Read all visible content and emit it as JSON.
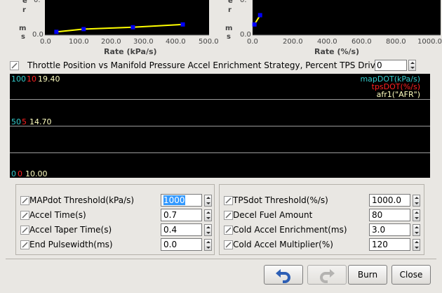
{
  "left_chart": {
    "y_axis_letters": [
      "e",
      "r",
      "m",
      "s"
    ],
    "y_ticks": [
      "0.0"
    ],
    "x_ticks": [
      "0.0",
      "100.0",
      "200.0",
      "300.0",
      "400.0",
      "500.0"
    ],
    "x_label": "Rate (kPa/s)"
  },
  "right_chart": {
    "y_axis_letters": [
      "e",
      "r",
      "m",
      "s"
    ],
    "y_ticks": [
      "0.0"
    ],
    "x_ticks": [
      "0.0",
      "200.0",
      "400.0",
      "600.0",
      "800.0",
      "1000.0"
    ],
    "x_label": "Rate (%/s)"
  },
  "chart_data": [
    {
      "type": "line",
      "xlabel": "Rate (kPa/s)",
      "x": [
        35,
        118,
        268,
        420
      ],
      "y": [
        0.1,
        0.25,
        0.35,
        0.5
      ],
      "xlim": [
        0,
        500
      ],
      "line_color": "#ffff00",
      "point_color": "#0000ff"
    },
    {
      "type": "line",
      "xlabel": "Rate (%/s)",
      "x": [
        10,
        40
      ],
      "y": [
        0.5,
        1.0
      ],
      "xlim": [
        0,
        1000
      ],
      "line_color": "#ffff00",
      "point_color": "#0000ff"
    }
  ],
  "strategy": {
    "label": "Throttle Position vs Manifold Pressure Accel Enrichment Strategy, Percent TPS Driven(%)",
    "value": "0"
  },
  "plot": {
    "top": {
      "map": "100",
      "tps": "10",
      "afr": "19.40"
    },
    "mid": {
      "map": "50",
      "tps": "5",
      "afr": "14.70"
    },
    "bottom": {
      "map": "0",
      "tps": "0",
      "afr": "10.00"
    },
    "legend": [
      "mapDOT(kPa/s)",
      "tpsDOT(%/s)",
      "afr1(\"AFR\")"
    ],
    "colors": {
      "map": "#33cccc",
      "tps": "#ff2020",
      "afr": "#ffffc0"
    }
  },
  "left_panel": [
    {
      "label": "MAPdot Threshold(kPa/s)",
      "value": "1000"
    },
    {
      "label": "Accel Time(s)",
      "value": "0.7"
    },
    {
      "label": "Accel Taper Time(s)",
      "value": "0.4"
    },
    {
      "label": "End Pulsewidth(ms)",
      "value": "0.0"
    }
  ],
  "right_panel": [
    {
      "label": "TPSdot Threshold(%/s)",
      "value": "1000.0"
    },
    {
      "label": "Decel Fuel Amount",
      "value": "80"
    },
    {
      "label": "Cold Accel Enrichment(ms)",
      "value": "3.0"
    },
    {
      "label": "Cold Accel Multiplier(%)",
      "value": "120"
    }
  ],
  "buttons": {
    "burn": "Burn",
    "close": "Close"
  }
}
